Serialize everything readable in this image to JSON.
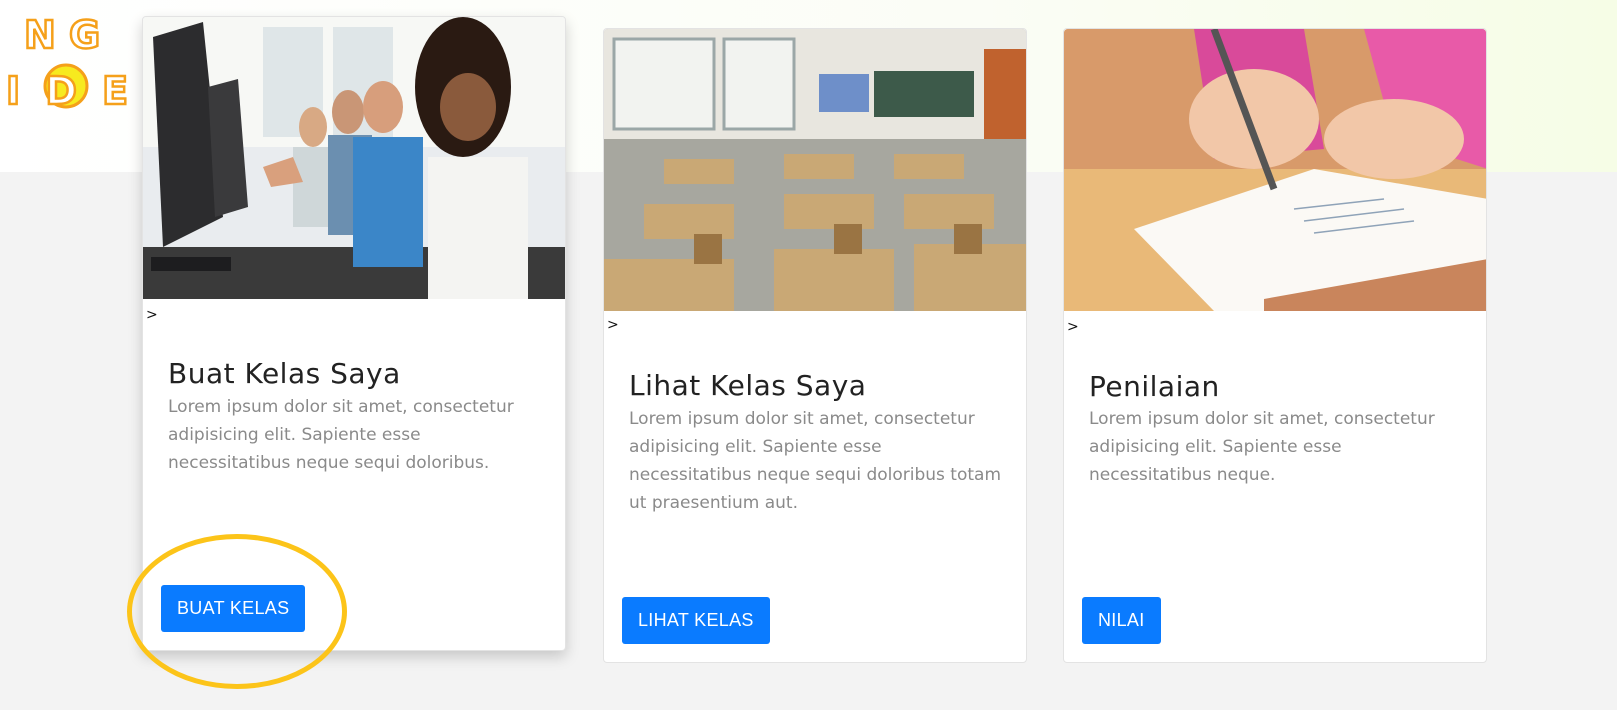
{
  "logo": {
    "line1": "N G",
    "line2": "I D E"
  },
  "cards": [
    {
      "arrow": ">",
      "title": "Buat Kelas Saya",
      "text": "Lorem ipsum dolor sit amet, consectetur adipisicing elit. Sapiente esse necessitatibus neque sequi doloribus.",
      "button_label": "BUAT KELAS"
    },
    {
      "arrow": ">",
      "title": "Lihat Kelas Saya",
      "text": "Lorem ipsum dolor sit amet, consectetur adipisicing elit. Sapiente esse necessitatibus neque sequi doloribus totam ut praesentium aut.",
      "button_label": "LIHAT KELAS"
    },
    {
      "arrow": ">",
      "title": "Penilaian",
      "text": "Lorem ipsum dolor sit amet, consectetur adipisicing elit. Sapiente esse necessitatibus neque.",
      "button_label": "NILAI"
    }
  ],
  "colors": {
    "button": "#0a7bff",
    "highlight": "#fcc419",
    "logo_orange": "#f5a01a",
    "logo_yellow": "#f7ea1f"
  }
}
